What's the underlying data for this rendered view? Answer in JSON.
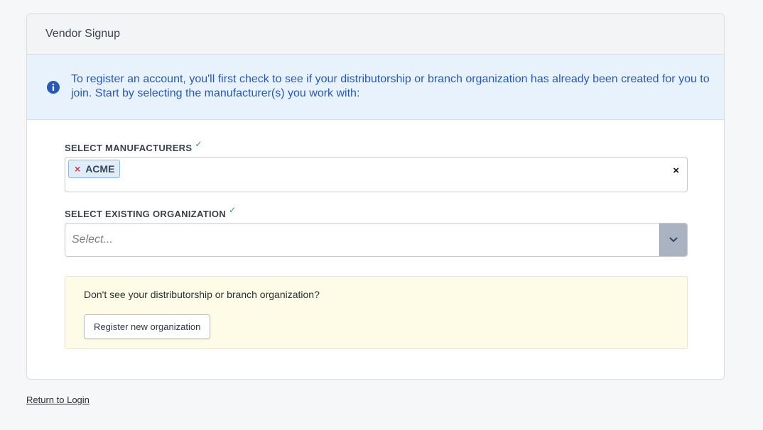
{
  "card": {
    "title": "Vendor Signup"
  },
  "info_banner": {
    "icon": "info-icon",
    "text": "To register an account, you'll first check to see if your distributorship or branch organization has already been created for you to join. Start by selecting the manufacturer(s) you work with:"
  },
  "manufacturers": {
    "label": "SELECT MANUFACTURERS",
    "check": "✓",
    "selected": [
      "ACME"
    ],
    "remove_symbol": "×",
    "clear_symbol": "×"
  },
  "organization": {
    "label": "SELECT EXISTING ORGANIZATION",
    "check": "✓",
    "placeholder": "Select..."
  },
  "notice": {
    "text": "Don't see your distributorship or branch organization?",
    "button_label": "Register new organization"
  },
  "footer": {
    "return_link": "Return to Login"
  },
  "colors": {
    "info_text": "#2659b8",
    "chip_bg": "#deedf9",
    "check": "#2aa04a",
    "notice_bg": "#fefce7"
  }
}
